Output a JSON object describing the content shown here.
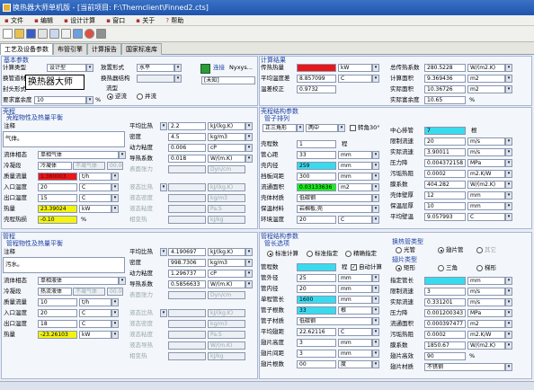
{
  "window": {
    "title": "换热器大师单机版 - [当前项目: F:\\Themclient\\Finned2.cts]"
  },
  "menu": [
    "文件",
    "编辑",
    "设计计算",
    "窗口",
    "关于",
    "帮助"
  ],
  "tabs": [
    "工艺及设备参数",
    "布管引擎",
    "计算报告",
    "国家标准库"
  ],
  "tooltip": "换热器大师",
  "basic": {
    "title": "基本参数",
    "calc_type_label": "计算类型",
    "calc_type": "设计型",
    "arrangement_label": "换管道材质",
    "arrangement": "",
    "tube_label": "封头形式",
    "tube": "",
    "margin_label": "要求富余度",
    "margin": "10",
    "margin_unit": "%",
    "orient_label": "放置形式",
    "orient": "水平",
    "sep_label": "换热器结构",
    "sep": "",
    "shell_form": "",
    "flow_label": "流型",
    "flow_opt1": "逆流",
    "flow_opt2": "并流",
    "link_label": "连接",
    "link_val": "Nyxys...",
    "link_sub": "[未知]"
  },
  "result": {
    "title": "计算结果",
    "ht_label": "传热热量",
    "ht": "",
    "ht_unit": "kW",
    "dt_label": "平均温度差",
    "dt": "8.857099",
    "dt_unit": "C",
    "corr_label": "温差校正",
    "corr": "0.9732",
    "area_label": "总传热系数",
    "area": "280.5228",
    "area_unit": "W/(m2.K)",
    "calc_area_label": "计算面积",
    "calc_area": "9.369436",
    "calc_area_unit": "m2",
    "real_area_label": "实际面积",
    "real_area": "10.36726",
    "real_area_unit": "m2",
    "real_margin_label": "实际富余度",
    "real_margin": "10.65",
    "real_margin_unit": "%"
  },
  "shell": {
    "title": "壳程",
    "sub": "壳程物性及热量平衡",
    "note_label": "注释",
    "note": "气体。",
    "medium_label": "流体相态",
    "medium": "单相气体",
    "gas_label": "冷凝段",
    "gas": "冷凝体",
    "gas2": "不凝气体",
    "gas_pct": "00.00",
    "flow_label": "质量流量",
    "flow": "1.380003",
    "flow_unit": "t/h",
    "in_label": "入口温度",
    "in": "20",
    "in_unit": "C",
    "out_label": "出口温度",
    "out": "15",
    "out_unit": "C",
    "heat_label": "热量",
    "heat": "23.39024",
    "heat_unit": "kW",
    "press_label": "壳程热损",
    "press": "-0.10",
    "press_unit": "%",
    "cp_label": "平均比热",
    "cp": "2.2",
    "cp_unit": "kJ/(kg.K)",
    "dens_label": "密度",
    "dens": "4.5",
    "dens_unit": "kg/m3",
    "visc_label": "动力粘度",
    "visc": "0.006",
    "visc_unit": "cP",
    "cond_label": "导热系数",
    "cond": "0.018",
    "cond_unit": "W/(m.K)",
    "ht_label": "表面张力",
    "ht_unit": "Dyn/cm",
    "g_cp_label": "液态比热",
    "g_cp_unit": "kJ/(kg.K)",
    "g_dens_label": "液态密度",
    "g_dens_unit": "kg/m3",
    "g_visc_label": "液态粘度",
    "g_visc_unit": "Pa.S",
    "g_cond_label": "液态导热",
    "g_cond_unit": "W/(m.K)",
    "latent_label": "相变热",
    "latent_unit": "kJ/kg"
  },
  "shellstruct": {
    "title": "壳程结构参数",
    "sub": "管子排列",
    "pitch_label": "正三角形",
    "pitch": "30",
    "pitch2": "两中",
    "rot_label": "转角30°",
    "rows_label": "壳程数",
    "rows": "1",
    "rows_unit": "程",
    "dist_label": "管心距",
    "dist": "33",
    "dist_unit": "mm",
    "shell_id_label": "壳内径",
    "shell_id": "259",
    "shell_id_unit": "mm",
    "baffle_label": "挡板间距",
    "baffle": "300",
    "baffle_unit": "mm",
    "flowarea_label": "流通面积",
    "flowarea": "0.03133636",
    "flowarea_unit": "m2",
    "mat_label": "壳体材质",
    "mat": "低碳钢",
    "fouling_label": "保温材料",
    "fouling": "岩棉板,壳",
    "env_label": "环境温度",
    "env": "20",
    "env_unit": "C",
    "center_label": "中心排管",
    "center": "7",
    "center_unit": "根",
    "speed_label": "限制流速",
    "speed": "20",
    "speed_unit": "m/s",
    "real_speed_label": "实际流速",
    "real_speed": "3.90011",
    "real_speed_unit": "m/s",
    "dp_label": "压力降",
    "dp": "0.004372158",
    "dp_unit": "MPa",
    "fou_label": "污垢热阻",
    "fou": "0.0002",
    "fou_unit": "m2.K/W",
    "hc_label": "膜系数",
    "hc": "404.282",
    "hc_unit": "W/(m2.K)",
    "thick_label": "壳体壁厚",
    "thick": "12",
    "thick_unit": "mm",
    "ins_label": "保温层厚",
    "ins": "10",
    "ins_unit": "mm",
    "avg_label": "平均壁温",
    "avg": "9.057993",
    "avg_unit": "C"
  },
  "tube": {
    "title": "管程",
    "sub": "管程物性及热量平衡",
    "note_label": "注释",
    "note": "污水。",
    "medium_label": "流体相态",
    "medium": "单相液体",
    "gas_label": "冷凝段",
    "gas": "热流液体",
    "gas2": "不凝气体",
    "gas_pct": "00.00",
    "flow_label": "质量流量",
    "flow": "10",
    "flow_unit": "t/h",
    "in_label": "入口温度",
    "in": "20",
    "in_unit": "C",
    "out_label": "出口温度",
    "out": "18",
    "out_unit": "C",
    "heat_label": "热量",
    "heat": "-23.26103",
    "heat_unit": "kW",
    "cp_label": "平均比热",
    "cp": "4.190697",
    "cp_unit": "kJ/(kg.K)",
    "dens_label": "密度",
    "dens": "998.7306",
    "dens_unit": "kg/m3",
    "visc_label": "动力粘度",
    "visc": "1.296737",
    "visc_unit": "cP",
    "cond_label": "导热系数",
    "cond": "0.5856633",
    "cond_unit": "W/(m.K)",
    "ht_label": "表面张力",
    "ht_unit": "Dyn/cm",
    "g_cp_label": "液态比热",
    "g_cp_unit": "kJ/(kg.K)",
    "g_dens_label": "液态密度",
    "g_dens_unit": "kg/m3",
    "g_visc_label": "液态粘度",
    "g_visc_unit": "Pa.S",
    "g_cond_label": "液态导热",
    "g_cond_unit": "W/(m.K)",
    "latent_label": "相变热",
    "latent_unit": "kJ/kg"
  },
  "tubestruct": {
    "title": "管程结构参数",
    "sub": "管长选项",
    "opt1": "标准计算",
    "opt2": "标准指定",
    "opt3": "精确指定",
    "count_label": "管程数",
    "count": "",
    "count_unit": "程",
    "auto_label": "自动计算",
    "od_label": "管外径",
    "od": "25",
    "od_unit": "mm",
    "id_label": "管内径",
    "id": "20",
    "id_unit": "mm",
    "len_label": "单程管长",
    "len": "1600",
    "len_unit": "mm",
    "num_label": "管子根数",
    "num": "33",
    "num_unit": "根",
    "mat_label": "管子材质",
    "mat": "低碳钢",
    "gap_label": "平均翅距",
    "gap": "22.62116",
    "gap_unit": "C",
    "fin_h_label": "翅片高度",
    "fin_h": "3",
    "fin_h_unit": "mm",
    "fin_s_label": "翅片间距",
    "fin_s": "3",
    "fin_s_unit": "mm",
    "fin_t_label": "翅片根数",
    "fin_t": "00",
    "fin_t_unit": "度",
    "type_title": "换热管类型",
    "t1": "光管",
    "t2": "翅片管",
    "t3": "其它",
    "fin_title": "翅片类型",
    "f1": "矩形",
    "f2": "三角",
    "f3": "梯形",
    "spec_label": "指定管长",
    "spec": "",
    "spec_unit": "mm",
    "lim_label": "限制流速",
    "lim": "3",
    "lim_unit": "m/s",
    "rspeed_label": "实际流速",
    "rspeed": "0.331201",
    "rspeed_unit": "m/s",
    "dp_label": "压力降",
    "dp": "0.001200343",
    "dp_unit": "MPa",
    "area_label": "流通面积",
    "area": "0.000397477",
    "area_unit": "m2",
    "fou_label": "污垢热阻",
    "fou": "0.0002",
    "fou_unit": "m2.K/W",
    "hc_label": "膜系数",
    "hc": "1850.67",
    "hc_unit": "W/(m2.K)",
    "fin_eff_label": "翅片高效",
    "fin_eff": "90",
    "fin_eff_unit": "%",
    "fin_mat_label": "翅片材质",
    "fin_mat": "不锈钢"
  }
}
